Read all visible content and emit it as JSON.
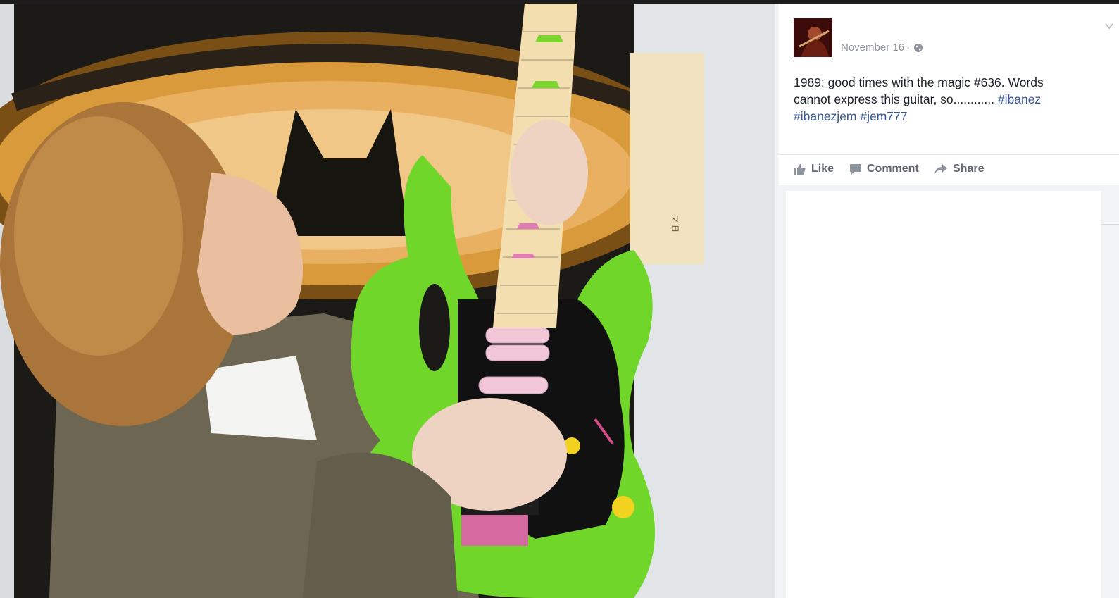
{
  "post": {
    "date": "November 16",
    "separator": "·",
    "audience_icon": "globe-icon",
    "menu_icon": "chevron-down-icon",
    "text_main": "1989: good times with the magic #636. Words cannot express this guitar, so............ ",
    "hashtags": [
      "#ibanez",
      "#ibanezjem",
      "#jem777"
    ]
  },
  "actions": {
    "like_label": "Like",
    "comment_label": "Comment",
    "share_label": "Share"
  },
  "colors": {
    "link": "#365899",
    "action_text": "#606770",
    "meta_text": "#90949c",
    "guitar_green": "#6fd627"
  }
}
